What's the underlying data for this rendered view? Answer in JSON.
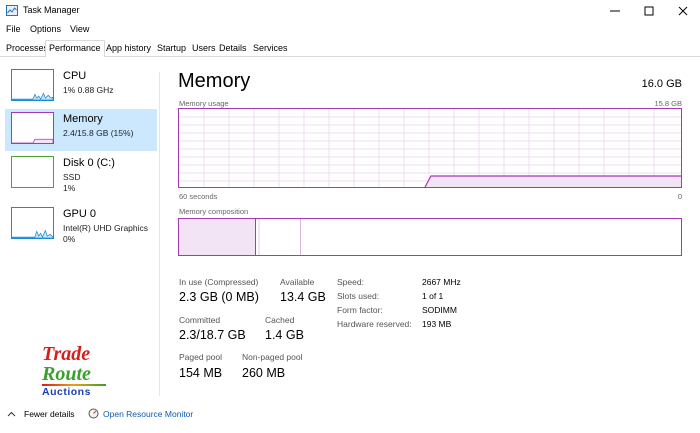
{
  "window": {
    "title": "Task Manager"
  },
  "menu": [
    "File",
    "Options",
    "View"
  ],
  "tabs": [
    "Processes",
    "Performance",
    "App history",
    "Startup",
    "Users",
    "Details",
    "Services"
  ],
  "active_tab": "Performance",
  "sidebar": [
    {
      "name": "CPU",
      "sub1": "1%  0.88 GHz",
      "sub2": "",
      "sub3": ""
    },
    {
      "name": "Memory",
      "sub1": "2.4/15.8 GB (15%)",
      "sub2": "",
      "sub3": ""
    },
    {
      "name": "Disk 0 (C:)",
      "sub1": "SSD",
      "sub2": "1%",
      "sub3": ""
    },
    {
      "name": "GPU 0",
      "sub1": "Intel(R) UHD Graphics",
      "sub2": "0%",
      "sub3": ""
    }
  ],
  "main": {
    "title": "Memory",
    "total": "16.0 GB",
    "usage_label": "Memory usage",
    "usage_max": "15.8 GB",
    "time_left": "60 seconds",
    "time_right": "0",
    "composition_label": "Memory composition",
    "stats": {
      "in_use_label": "In use (Compressed)",
      "in_use": "2.3 GB (0 MB)",
      "available_label": "Available",
      "available": "13.4 GB",
      "committed_label": "Committed",
      "committed": "2.3/18.7 GB",
      "cached_label": "Cached",
      "cached": "1.4 GB",
      "paged_label": "Paged pool",
      "paged": "154 MB",
      "nonpaged_label": "Non-paged pool",
      "nonpaged": "260 MB"
    },
    "hardware": [
      {
        "label": "Speed:",
        "value": "2667 MHz"
      },
      {
        "label": "Slots used:",
        "value": "1 of 1"
      },
      {
        "label": "Form factor:",
        "value": "SODIMM"
      },
      {
        "label": "Hardware reserved:",
        "value": "193 MB"
      }
    ]
  },
  "footer": {
    "fewer": "Fewer details",
    "monitor": "Open Resource Monitor"
  },
  "logo": {
    "trade": "Trade",
    "route": "Route",
    "auctions": "Auctions"
  },
  "colors": {
    "accent": "#a33ab3",
    "selected": "#cce8ff",
    "cpu": "#1a8ad4",
    "disk": "#4ca233",
    "link": "#0a5bb5"
  }
}
